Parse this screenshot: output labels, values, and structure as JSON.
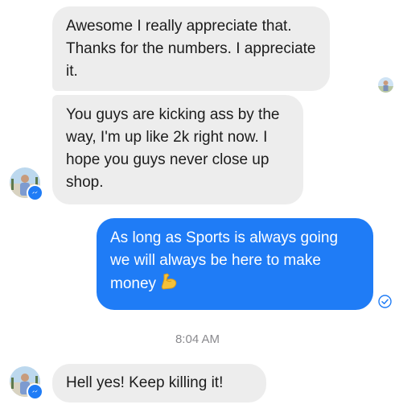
{
  "messages": {
    "m1": "Awesome I really appreciate that. Thanks for the numbers. I appreciate it.",
    "m2": "You guys are kicking ass by the way, I'm up like 2k right now. I hope you guys never close up shop.",
    "m3": "As long as Sports is always going we will always be here to make money",
    "m3_emoji": "flexed-biceps-emoji",
    "m4": "Hell yes! Keep killing it!"
  },
  "timestamp": "8:04 AM",
  "colors": {
    "outgoing_bubble": "#1f7cf6",
    "incoming_bubble": "#ededed",
    "timestamp_text": "#8a8a8e"
  },
  "icons": {
    "messenger_badge": "messenger-badge-icon",
    "seen_avatar": "seen-avatar-icon",
    "sent_check": "sent-check-icon"
  }
}
